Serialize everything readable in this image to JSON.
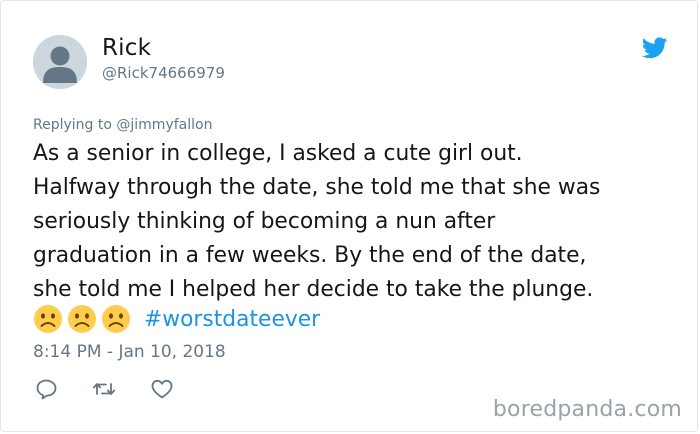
{
  "tweet": {
    "author_name": "Rick",
    "author_handle": "@Rick74666979",
    "reply_prefix": "Replying to",
    "reply_to": "@jimmyfallon",
    "text": "As a senior in college, I asked a cute girl out.\nHalfway through the date, she told me that she was\nseriously thinking of becoming a nun after\ngraduation in a few weeks. By the end of the date,\nshe told me I helped her decide to take the plunge.",
    "emoji_count": 3,
    "emoji_name": "frowning-face-emoji",
    "hashtag": "#worstdateever",
    "timestamp": "8:14 PM - Jan 10, 2018"
  },
  "icons": {
    "brand": "twitter-bird-icon",
    "actions": [
      "reply-icon",
      "retweet-icon",
      "like-icon"
    ]
  },
  "watermark": "boredpanda.com",
  "colors": {
    "text": "#14171a",
    "secondary": "#657786",
    "link": "#1b95e0",
    "brand": "#1da1f2",
    "border": "#e1e8ed",
    "watermark": "#9aa3aa"
  }
}
